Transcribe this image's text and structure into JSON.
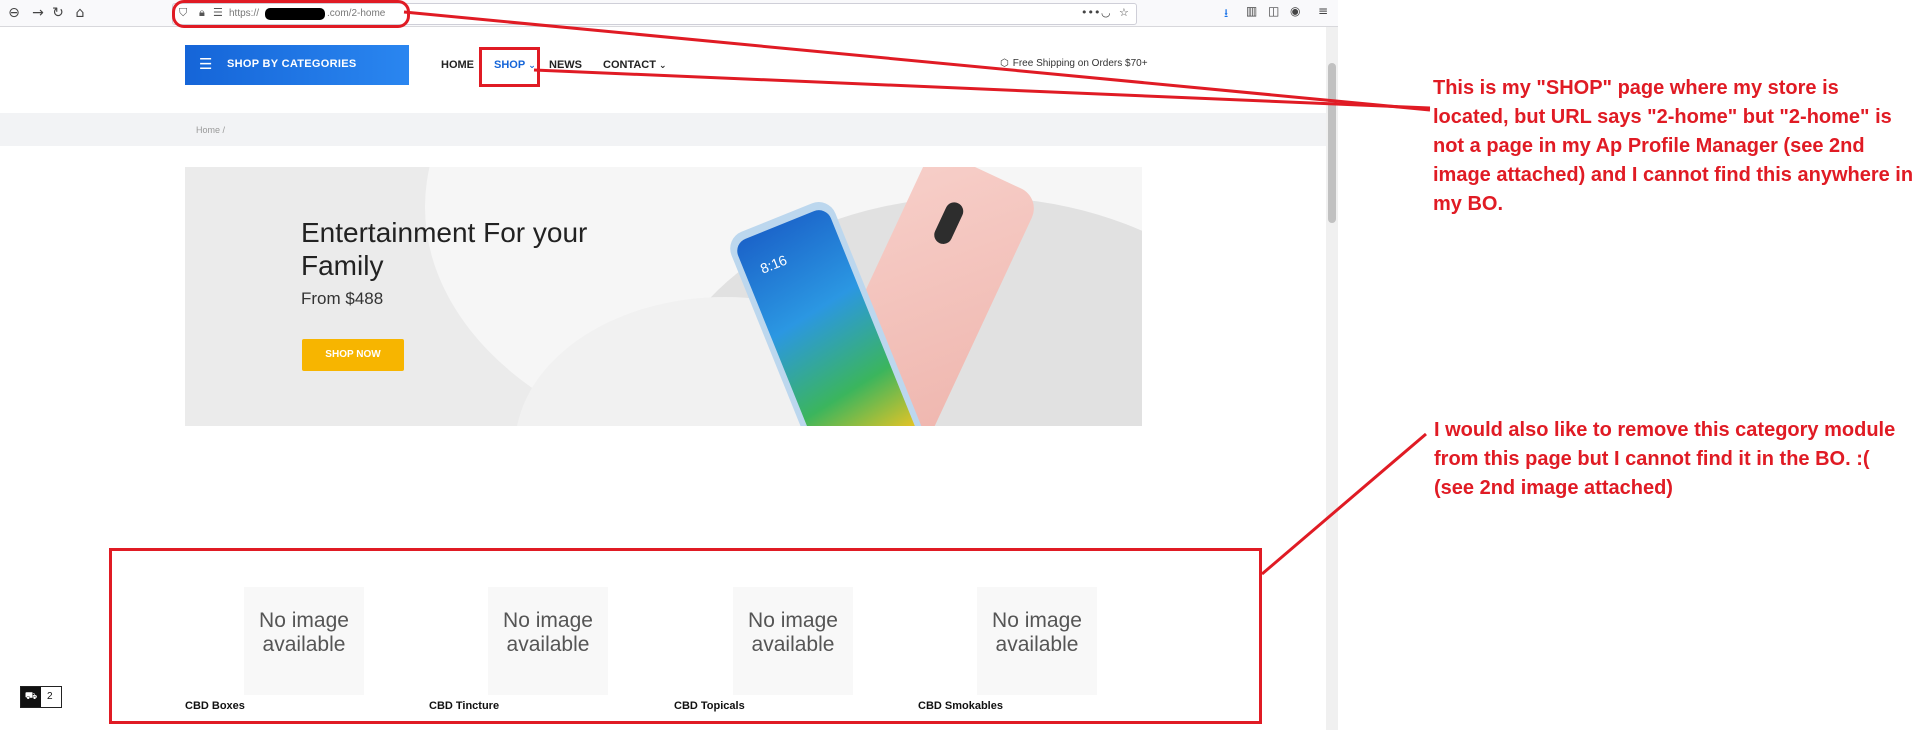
{
  "browser": {
    "url_prefix": "https://",
    "url_suffix": ".com/2-home",
    "nav_back_icon": "back-arrow-icon",
    "nav_forward_icon": "forward-arrow-icon",
    "reload_icon": "reload-icon",
    "home_icon": "home-icon",
    "page_actions_icon": "more-dots-icon",
    "download_count": "",
    "more_dots": "•••"
  },
  "header": {
    "categories_button": "SHOP BY CATEGORIES",
    "nav": [
      {
        "label": "HOME"
      },
      {
        "label": "SHOP"
      },
      {
        "label": "NEWS"
      },
      {
        "label": "CONTACT"
      }
    ],
    "shipping_text": "Free Shipping on Orders $70+"
  },
  "breadcrumb": {
    "text": "Home /"
  },
  "hero": {
    "title": "Entertainment For your Family",
    "price": "From $488",
    "button": "SHOP NOW",
    "phone_time": "8:16"
  },
  "categories": [
    {
      "thumb": "No image available",
      "name": "CBD Boxes"
    },
    {
      "thumb": "No image available",
      "name": "CBD Tincture"
    },
    {
      "thumb": "No image available",
      "name": "CBD Topicals"
    },
    {
      "thumb": "No image available",
      "name": "CBD Smokables"
    }
  ],
  "cart": {
    "count": "2"
  },
  "annotations": {
    "top": "This is my \"SHOP\" page where my store is located, but URL says \"2-home\" but \"2-home\" is not a page in my Ap Profile Manager (see 2nd image attached) and I cannot find this anywhere in my BO.",
    "bottom": "I would also like to remove this category module from this page but I cannot find it in the BO.  :(\n(see 2nd image attached)"
  },
  "colors": {
    "accent_blue": "#1565d8",
    "button_yellow": "#f7b500",
    "annotation_red": "#e01b24"
  }
}
